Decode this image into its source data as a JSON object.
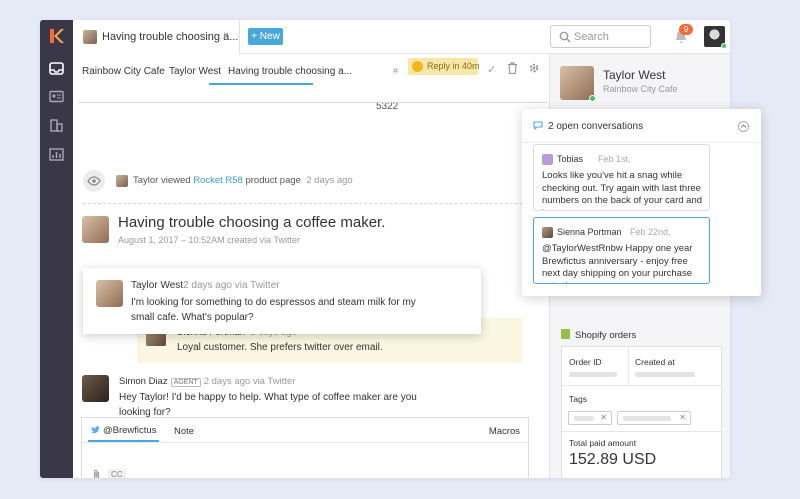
{
  "topbar": {
    "tab_title": "Having trouble choosing a...",
    "tab_close": "×",
    "new_button": "+ New",
    "search_placeholder": "Search",
    "notifications_count": "9"
  },
  "conversation": {
    "breadcrumbs": [
      "Rainbow City Cafe",
      "Taylor West",
      "Having trouble choosing a..."
    ],
    "hash": "#",
    "ticket_number": "5322",
    "reply_label": "Reply in 40m",
    "viewed": {
      "name": "Taylor viewed",
      "link": "Rocket R58",
      "suffix": "product page",
      "time": "2 days ago"
    },
    "subject": "Having trouble choosing a coffee maker.",
    "subject_meta": "August 1, 2017 – 10:52AM created via Twitter",
    "customer_message": {
      "name": "Taylor West",
      "meta": "2 days ago via Twitter",
      "body": "I'm looking for something to do espressos and steam milk for my small cafe. What's popular?"
    },
    "note": {
      "name": "Sienna Portman",
      "time": "2 days ago",
      "body": "Loyal customer. She prefers twitter over email."
    },
    "agent_message": {
      "name": "Simon Diaz",
      "tag": "AGENT",
      "meta": "2 days ago via Twitter",
      "body": "Hey Taylor! I'd be happy to help. What type of coffee maker are you looking for?"
    },
    "composer": {
      "channel": "@Brewfictus",
      "note_tab": "Note",
      "macros": "Macros",
      "cc": "CC"
    }
  },
  "sidebar": {
    "customer_name": "Taylor West",
    "company": "Rainbow City Cafe",
    "open_conversations": "2 open conversations",
    "cards": [
      {
        "name": "Tobias",
        "date": "Feb 1st,",
        "text": "Looks like you've hit a snag while checking out. Try again with last three numbers on the back of your card and it"
      },
      {
        "name": "Sienna Portman",
        "date": "Feb 22nd,",
        "text": "@TaylorWestRnbw Happy one year Brewfictus anniversary - enjoy free next day shipping on your purchase today!"
      }
    ],
    "shopify": {
      "title": "Shopify orders",
      "order_id_label": "Order ID",
      "created_at_label": "Created at",
      "tags_label": "Tags",
      "total_label": "Total paid amount",
      "total_value": "152.89 USD"
    }
  },
  "colors": {
    "accent": "#4aa8d8",
    "rail": "#3a3749",
    "reply_bg": "#f6e7a8",
    "notification": "#f26b3a",
    "online": "#4bbe6a"
  }
}
